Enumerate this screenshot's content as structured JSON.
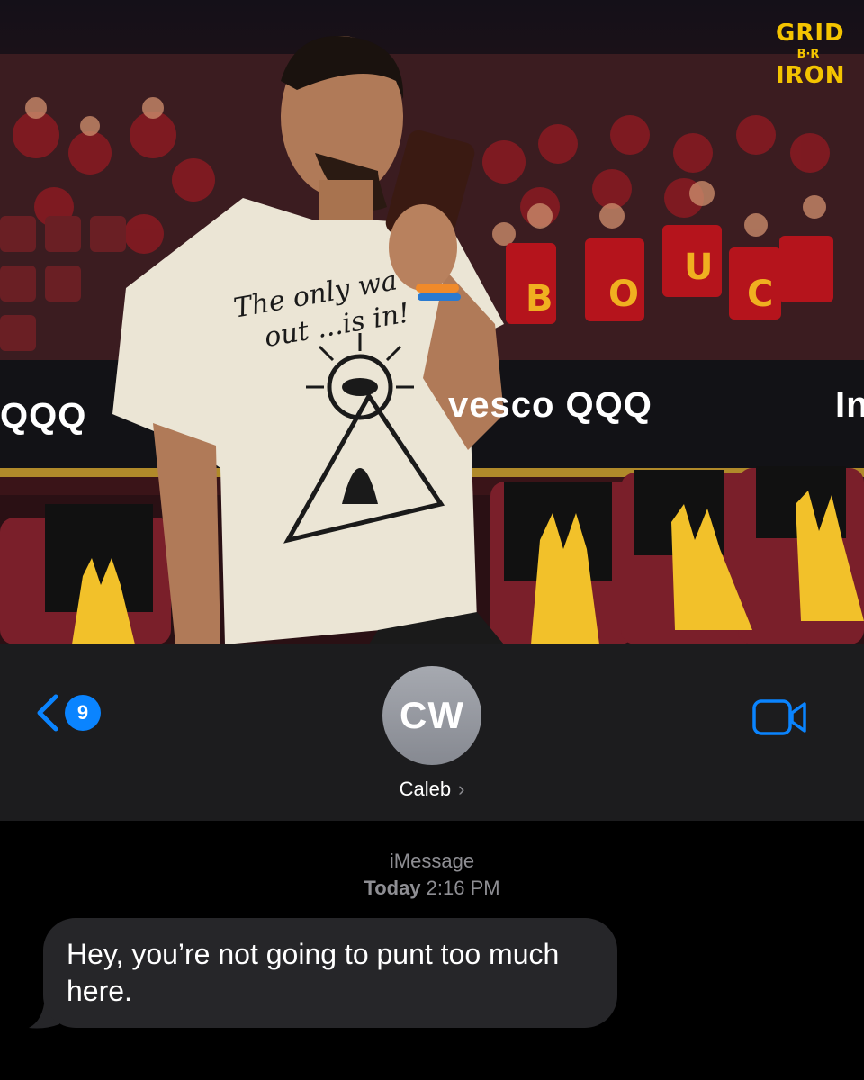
{
  "photo": {
    "logo": {
      "line1": "GRID",
      "line2": "B·R",
      "line3": "IRON"
    },
    "banner_left": "QQQ",
    "banner_right": "vesco QQQ",
    "banner_far_right": "In",
    "shirt_line1": "The only wa",
    "shirt_line2": "out ...is in!"
  },
  "header": {
    "back_badge_count": "9",
    "avatar_initials": "CW",
    "contact_name": "Caleb",
    "contact_chevron": "›"
  },
  "conversation": {
    "service_label": "iMessage",
    "timestamp_day": "Today",
    "timestamp_time": "2:16 PM",
    "messages": [
      {
        "direction": "incoming",
        "text": "Hey, you’re not going to punt too much here."
      }
    ]
  },
  "colors": {
    "accent_blue": "#0a84ff",
    "header_bg": "#1c1c1e",
    "incoming_bubble": "#262629",
    "logo_yellow": "#f4c400"
  },
  "icons": [
    "back-chevron-icon",
    "video-camera-icon",
    "chevron-right-icon"
  ]
}
